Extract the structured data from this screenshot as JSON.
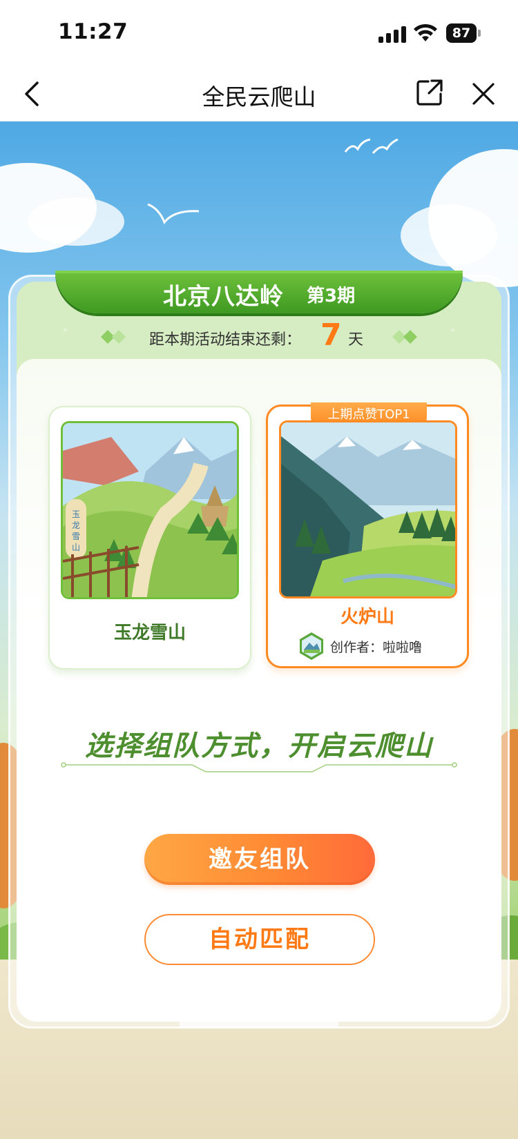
{
  "status_bar": {
    "time": "11:27",
    "battery": "87"
  },
  "nav": {
    "title": "全民云爬山"
  },
  "banner": {
    "title": "北京八达岭",
    "issue": "第3期"
  },
  "countdown": {
    "label": "距本期活动结束还剩：",
    "value": "7",
    "unit": "天"
  },
  "mountains": [
    {
      "name": "玉龙雪山"
    },
    {
      "name": "火炉山",
      "badge": "上期点赞TOP1",
      "creator": "创作者：啦啦噜"
    }
  ],
  "slogan": "选择组队方式，开启云爬山",
  "buttons": {
    "invite": "邀友组队",
    "auto_match": "自动匹配"
  },
  "colors": {
    "accent_orange": "#ff7a14",
    "green": "#4d8f2f",
    "banner_green": "#3f9a22"
  }
}
